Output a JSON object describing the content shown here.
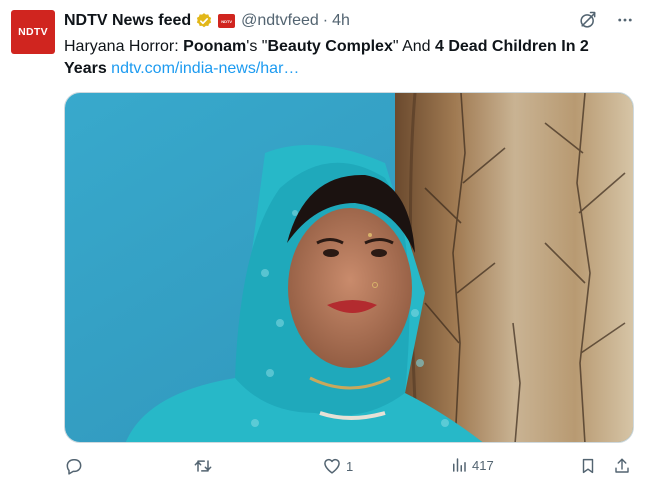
{
  "account": {
    "avatar_text": "NDTV",
    "name": "NDTV News feed",
    "affiliate_badge_text": "NDTV",
    "handle": "@ndtvfeed",
    "separator": "·",
    "time": "4h"
  },
  "tweet": {
    "part1": "Haryana Horror: ",
    "part2": "Poonam",
    "part3": "'s \"",
    "part4": "Beauty Complex",
    "part5": "\" And ",
    "part6": "4 Dead Children In 2 Years",
    "link": "ndtv.com/india-news/har…"
  },
  "media": {
    "description_icon": "photo"
  },
  "actions": {
    "reply_count": "",
    "retweet_count": "",
    "like_count": "1",
    "views_count": "417"
  },
  "colors": {
    "brand": "#d0251f",
    "link": "#1d9bf0",
    "muted": "#536471",
    "verified_gold": "#e2b719"
  }
}
